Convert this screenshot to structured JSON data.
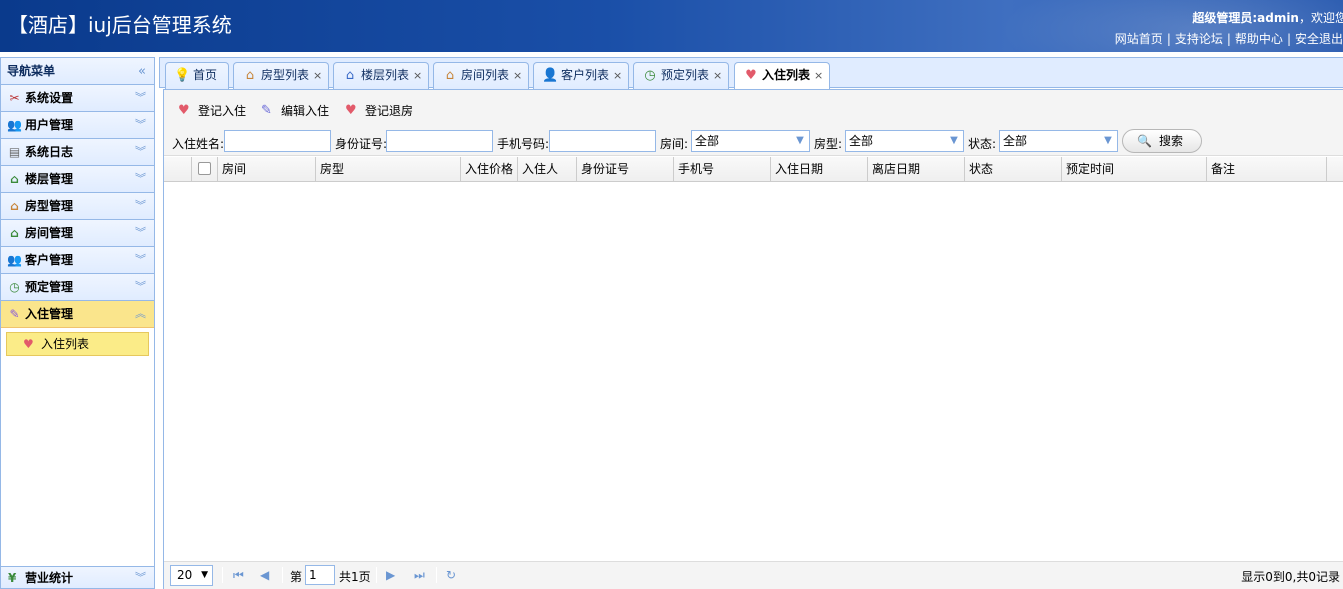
{
  "header": {
    "title": "【酒店】iuj后台管理系统",
    "welcome_role": "超级管理员:admin",
    "welcome_suffix": "，欢迎您",
    "links": [
      "网站首页",
      "支持论坛",
      "帮助中心",
      "安全退出"
    ],
    "colors": {
      "bg_dark": "#0a3a8c",
      "bg_light": "#3f6fc0"
    }
  },
  "sidebar": {
    "title": "导航菜单",
    "items": [
      {
        "label": "系统设置",
        "icon": "tools-icon"
      },
      {
        "label": "用户管理",
        "icon": "users-icon"
      },
      {
        "label": "系统日志",
        "icon": "log-icon"
      },
      {
        "label": "楼层管理",
        "icon": "house-icon"
      },
      {
        "label": "房型管理",
        "icon": "house-icon"
      },
      {
        "label": "房间管理",
        "icon": "house-icon"
      },
      {
        "label": "客户管理",
        "icon": "customers-icon"
      },
      {
        "label": "预定管理",
        "icon": "clock-icon"
      },
      {
        "label": "入住管理",
        "icon": "checkin-icon"
      }
    ],
    "active_sub": {
      "label": "入住列表",
      "icon": "heart-icon"
    },
    "bottom": {
      "label": "营业统计",
      "icon": "yen-icon"
    }
  },
  "tabs": [
    {
      "label": "首页",
      "icon": "bulb-icon",
      "closable": false
    },
    {
      "label": "房型列表",
      "icon": "house-icon",
      "closable": true
    },
    {
      "label": "楼层列表",
      "icon": "house-icon",
      "closable": true
    },
    {
      "label": "房间列表",
      "icon": "house-icon",
      "closable": true
    },
    {
      "label": "客户列表",
      "icon": "person-icon",
      "closable": true
    },
    {
      "label": "预定列表",
      "icon": "clock-icon",
      "closable": true
    },
    {
      "label": "入住列表",
      "icon": "heart-icon",
      "closable": true,
      "active": true
    }
  ],
  "tab_close_glyph": "×",
  "toolbar": {
    "add_label": "登记入住",
    "edit_label": "编辑入住",
    "checkout_label": "登记退房"
  },
  "search": {
    "name_label": "入住姓名:",
    "idcard_label": "身份证号:",
    "mobile_label": "手机号码:",
    "room_label": "房间:",
    "room_value": "全部",
    "roomtype_label": "房型:",
    "roomtype_value": "全部",
    "status_label": "状态:",
    "status_value": "全部",
    "search_button": "搜索"
  },
  "grid": {
    "columns": [
      "房间",
      "房型",
      "入住价格",
      "入住人",
      "身份证号",
      "手机号",
      "入住日期",
      "离店日期",
      "状态",
      "预定时间",
      "备注"
    ],
    "rows": []
  },
  "pager": {
    "page_size": "20",
    "page_prefix": "第",
    "page_number": "1",
    "page_suffix": "共1页",
    "info": "显示0到0,共0记录"
  }
}
